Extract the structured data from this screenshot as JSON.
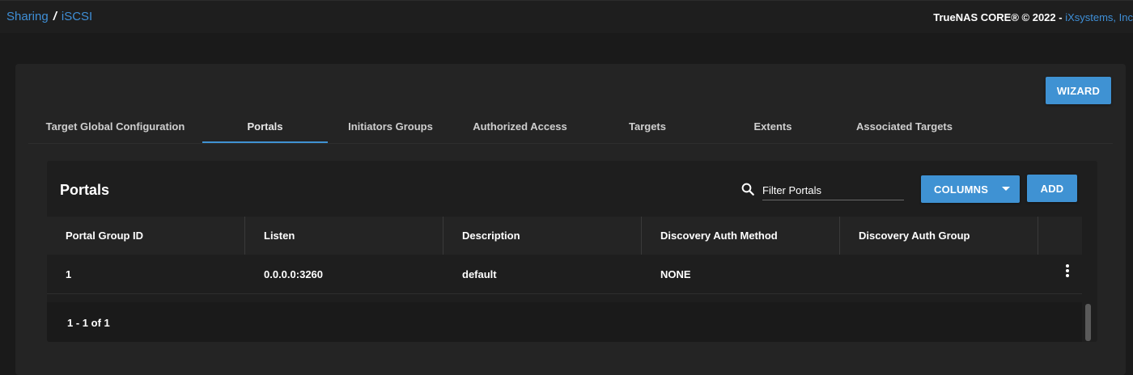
{
  "breadcrumb": {
    "parent": "Sharing",
    "separator": "/",
    "current": "iSCSI"
  },
  "copyright": {
    "text": "TrueNAS CORE® © 2022 - ",
    "vendor": "iXsystems, Inc"
  },
  "wizard_label": "WIZARD",
  "tabs": [
    {
      "label": "Target Global Configuration"
    },
    {
      "label": "Portals",
      "active": true
    },
    {
      "label": "Initiators Groups"
    },
    {
      "label": "Authorized Access"
    },
    {
      "label": "Targets"
    },
    {
      "label": "Extents"
    },
    {
      "label": "Associated Targets"
    }
  ],
  "panel": {
    "title": "Portals",
    "search": {
      "placeholder": "Filter Portals",
      "icon": "search-icon"
    },
    "columns_label": "COLUMNS",
    "add_label": "ADD"
  },
  "table": {
    "headers": [
      "Portal Group ID",
      "Listen",
      "Description",
      "Discovery Auth Method",
      "Discovery Auth Group"
    ],
    "rows": [
      {
        "portal_group_id": "1",
        "listen": "0.0.0.0:3260",
        "description": "default",
        "auth_method": "NONE",
        "auth_group": ""
      }
    ]
  },
  "pagination": "1 - 1 of 1",
  "colors": {
    "accent": "#3f92d3",
    "link": "#3f8fd7",
    "background": "#1a1a1a",
    "card": "#242424"
  }
}
